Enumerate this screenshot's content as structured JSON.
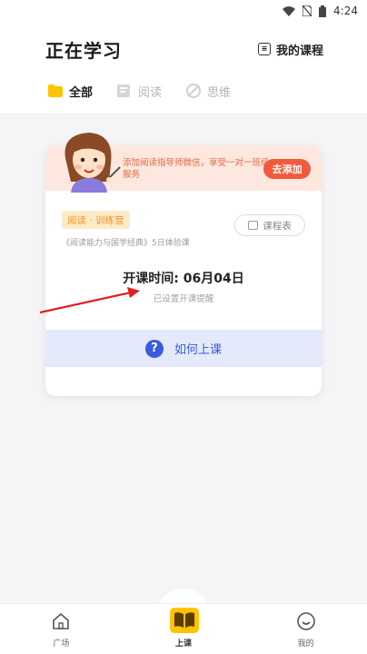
{
  "status_bar": {
    "time": "4:24"
  },
  "header": {
    "title": "正在学习",
    "my_courses_label": "我的课程"
  },
  "tabs": [
    {
      "label": "全部",
      "active": true
    },
    {
      "label": "阅读",
      "active": false
    },
    {
      "label": "思维",
      "active": false
    }
  ],
  "banner": {
    "text": "添加阅读指导师微信，享受一对一班级服务",
    "button": "去添加"
  },
  "course": {
    "badge": "阅读 · 训练营",
    "subtitle": "《阅读能力与国学经典》5日体验课",
    "schedule_button": "课程表",
    "start_time": "开课时间: 06月04日",
    "reminder": "已设置开课提醒"
  },
  "how_to": {
    "label": "如何上课",
    "icon": "?"
  },
  "bottom_nav": [
    {
      "label": "广场",
      "icon": "home-icon"
    },
    {
      "label": "上课",
      "icon": "book-icon"
    },
    {
      "label": "我的",
      "icon": "smile-icon"
    }
  ],
  "colors": {
    "accent": "#FFC400",
    "banner_bg": "#FDE7DE",
    "cta": "#EF5B3C",
    "link_blue": "#3B5BDB",
    "badge_bg": "#FDEBC6"
  }
}
